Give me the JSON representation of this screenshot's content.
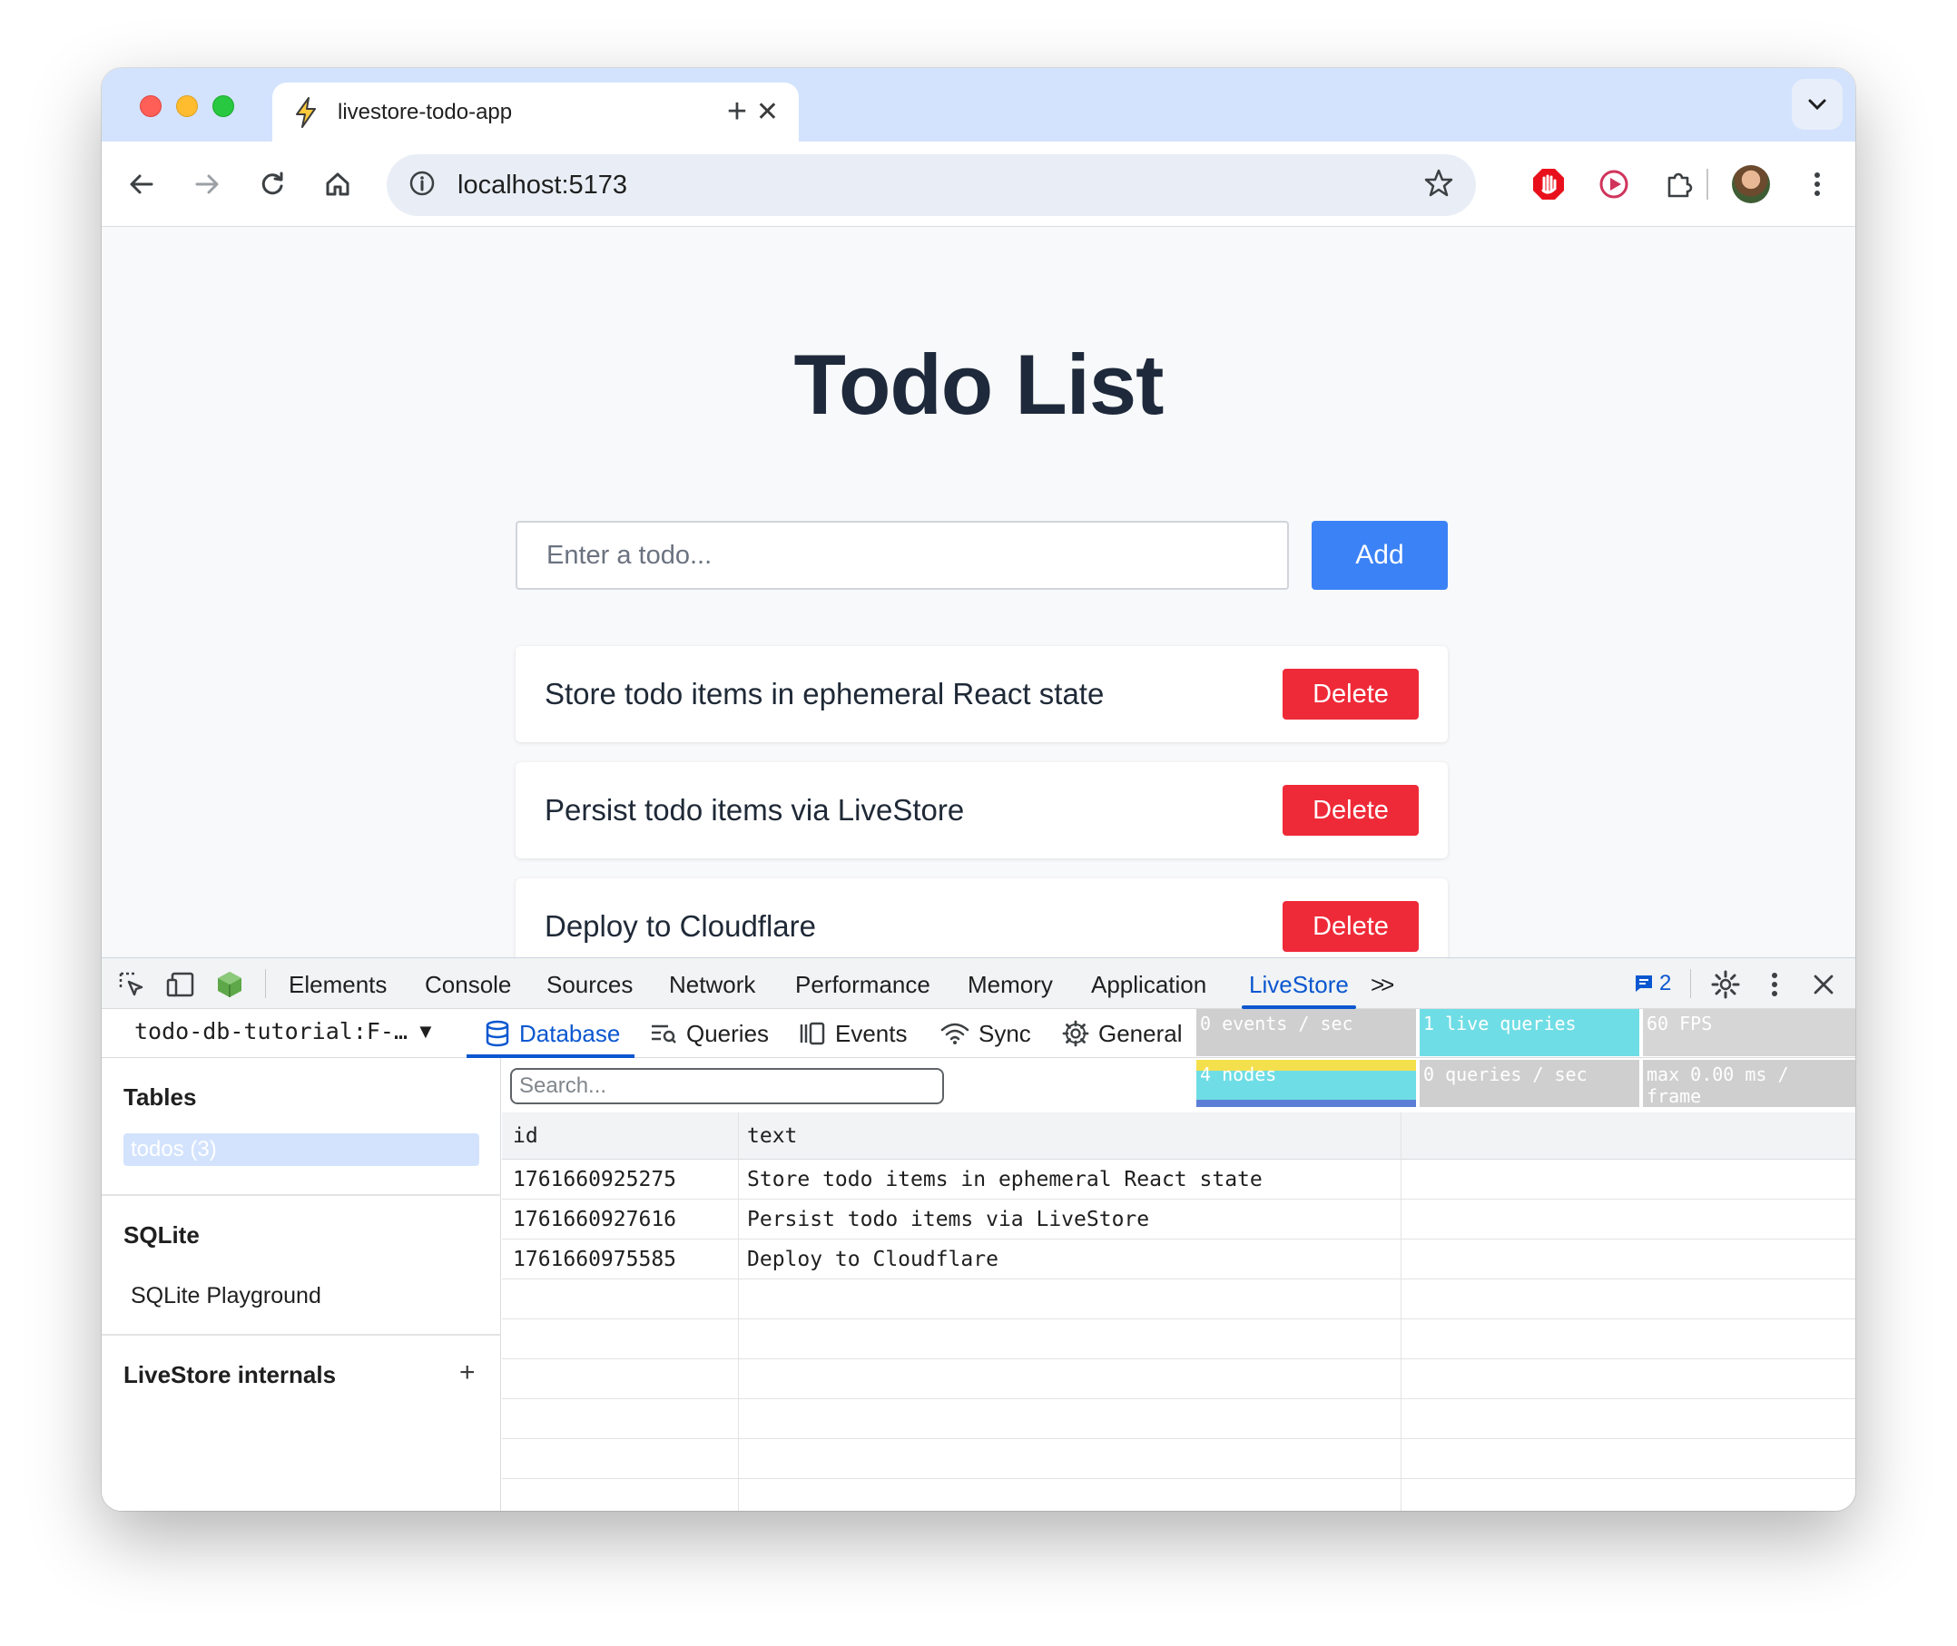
{
  "browser": {
    "tab_title": "livestore-todo-app",
    "url": "localhost:5173",
    "icons": [
      "back-icon",
      "forward-icon",
      "reload-icon",
      "home-icon",
      "site-info-icon",
      "bookmark-star-icon",
      "adblock-icon",
      "record-icon",
      "extensions-icon",
      "profile-avatar",
      "more-icon"
    ]
  },
  "app": {
    "title": "Todo List",
    "input_placeholder": "Enter a todo...",
    "add_label": "Add",
    "delete_label": "Delete",
    "todos": [
      {
        "text": "Store todo items in ephemeral React state"
      },
      {
        "text": "Persist todo items via LiveStore"
      },
      {
        "text": "Deploy to Cloudflare"
      }
    ],
    "colors": {
      "add": "#3b82f6",
      "delete": "#ef2a38"
    }
  },
  "devtools": {
    "tabs": [
      "Elements",
      "Console",
      "Sources",
      "Network",
      "Performance",
      "Memory",
      "Application",
      "LiveStore"
    ],
    "active_tab": "LiveStore",
    "more_tabs": ">>",
    "issues_count": "2",
    "livestore": {
      "store": "todo-db-tutorial:F-…",
      "subtabs": [
        "Database",
        "Queries",
        "Events",
        "Sync",
        "General"
      ],
      "active_subtab": "Database",
      "perf": {
        "events_per_sec": "0 events / sec",
        "live_queries": "1 live queries",
        "fps": "60 FPS",
        "nodes": "4 nodes",
        "queries_per_sec": "0 queries / sec",
        "max_frame": "max 0.00 ms / frame"
      },
      "sidebar": {
        "tables_heading": "Tables",
        "table_item": "todos (3)",
        "sqlite_heading": "SQLite",
        "sqlite_playground": "SQLite Playground",
        "internals_heading": "LiveStore internals",
        "expand": "+"
      },
      "search_placeholder": "Search...",
      "columns": [
        "id",
        "text"
      ],
      "rows": [
        {
          "id": "1761660925275",
          "text": "Store todo items in ephemeral React state"
        },
        {
          "id": "1761660927616",
          "text": "Persist todo items via LiveStore"
        },
        {
          "id": "1761660975585",
          "text": "Deploy to Cloudflare"
        }
      ]
    }
  }
}
